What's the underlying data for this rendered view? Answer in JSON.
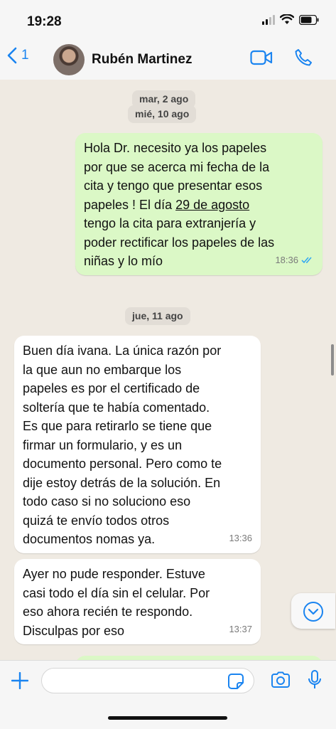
{
  "status": {
    "time": "19:28"
  },
  "header": {
    "back_count": "1",
    "contact_name": "Rubén Martinez"
  },
  "chat": {
    "date_chips": [
      "mar, 2 ago",
      "mié, 10 ago",
      "jue, 11 ago"
    ],
    "messages": [
      {
        "direction": "outgoing",
        "text_before": "Hola Dr. necesito ya los papeles\npor que se acerca mi fecha de la\ncita y tengo que presentar esos\npapeles ! El día ",
        "date_link": "29 de agosto",
        "text_after": "\ntengo la cita para extranjería y\npoder rectificar los papeles de las\nniñas y lo mío",
        "time": "18:36",
        "read": true
      },
      {
        "direction": "incoming",
        "text": "Buen día ivana. La única razón por\nla que aun no embarque los\npapeles es por el certificado de\nsoltería que te había comentado.\nEs que para retirarlo se tiene que\nfirmar un formulario, y es un\ndocumento personal. Pero como te\ndije estoy detrás de la solución. En\ntodo caso si no soluciono eso\nquizá te envío todos otros\ndocumentos nomas ya.",
        "time": "13:36"
      },
      {
        "direction": "incoming",
        "text": "Ayer no pude responder. Estuve\ncasi todo el día sin el celular. Por\neso ahora recién te respondo.\nDisculpas por eso",
        "time": "13:37"
      }
    ]
  },
  "composer": {
    "value": "",
    "placeholder": ""
  },
  "colors": {
    "accent": "#1a84f0",
    "outgoing_bubble": "#dbf8c6",
    "incoming_bubble": "#ffffff",
    "chat_bg": "#efeae2"
  }
}
